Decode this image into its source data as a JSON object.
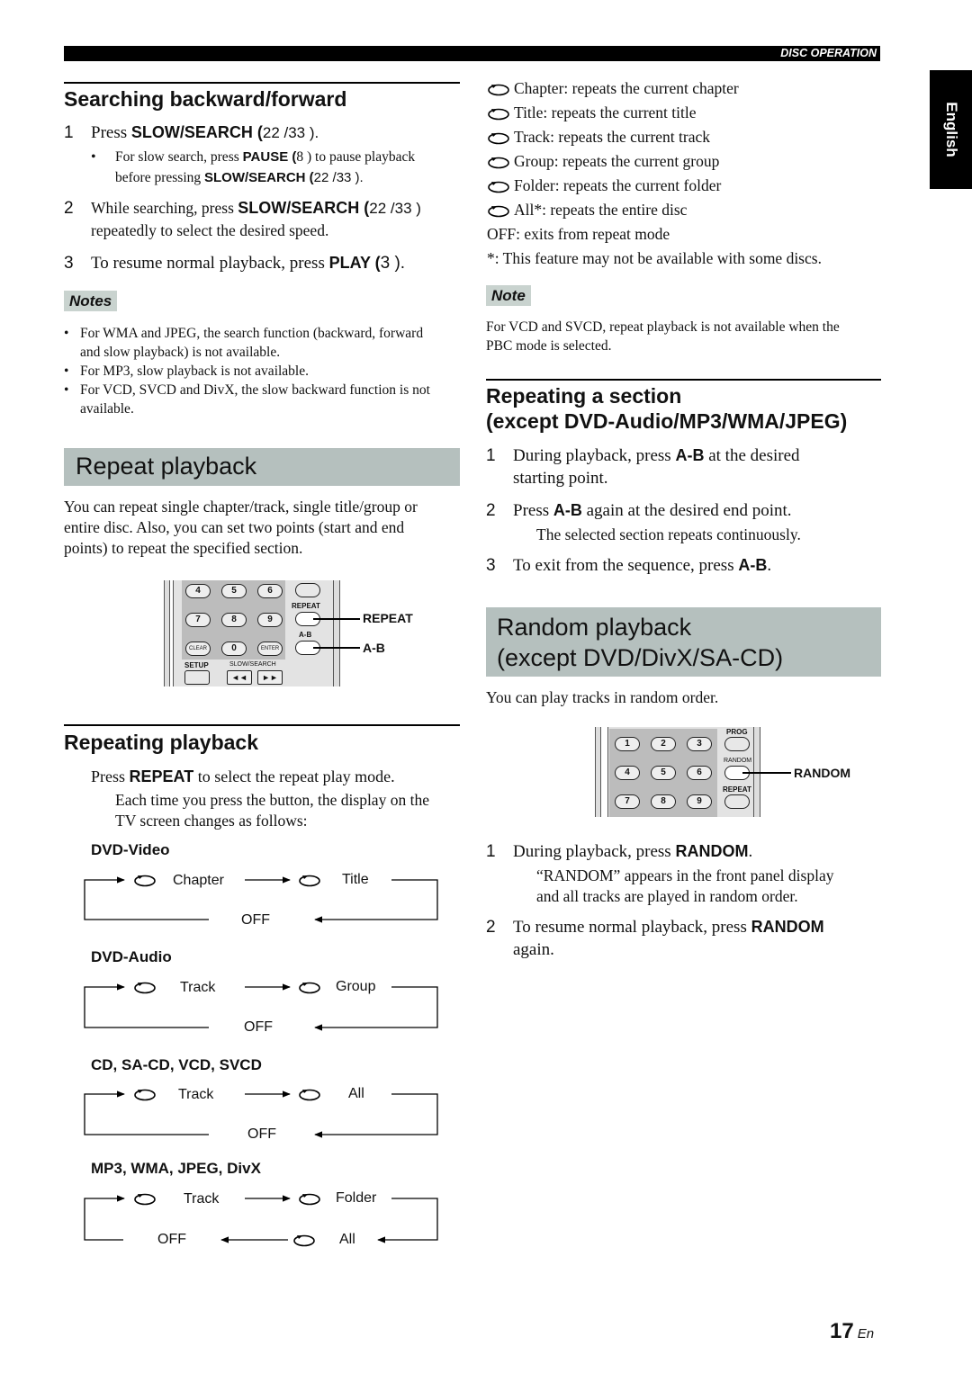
{
  "header": {
    "section": "DISC OPERATION",
    "language_tab": "English"
  },
  "searching": {
    "title": "Searching backward/forward",
    "steps": [
      {
        "num": "1",
        "pre": "Press ",
        "key": "SLOW/SEARCH (",
        "post": "22  /33  ).",
        "bullet": {
          "pre": "For slow search, press ",
          "key1": "PAUSE (",
          "mid1": "8  ) to pause playback",
          "line2_pre": "before pressing ",
          "key2": "SLOW/SEARCH (",
          "post": "22  /33  )."
        }
      },
      {
        "num": "2",
        "pre": "While searching, press ",
        "key": "SLOW/SEARCH (",
        "post": "22  /33  )",
        "line2": "repeatedly to select the desired speed."
      },
      {
        "num": "3",
        "pre": "To resume normal playback, press ",
        "key": "PLAY (",
        "post": "3  )."
      }
    ]
  },
  "notes": {
    "badge": "Notes",
    "items": [
      {
        "line1": "For WMA and JPEG, the search function (backward, forward",
        "line2": "and slow playback) is not available."
      },
      {
        "line1": "For MP3, slow playback is not available.",
        "line2": ""
      },
      {
        "line1": "For VCD, SVCD and DivX, the slow backward function is not",
        "line2": "available."
      }
    ]
  },
  "repeat_playback": {
    "band_title": "Repeat playback",
    "intro": [
      "You can repeat single chapter/track, single title/group or",
      "entire disc. Also, you can set two points (start and end",
      "points) to repeat the specified section."
    ],
    "remote": {
      "keys_row1": [
        "4",
        "5",
        "6"
      ],
      "keys_row2": [
        "7",
        "8",
        "9"
      ],
      "keys_row3": [
        "CLEAR",
        "0",
        "ENTER"
      ],
      "small_repeat": "REPEAT",
      "small_ab": "A-B",
      "setup": "SETUP",
      "slow_search": "SLOW/SEARCH",
      "callout_repeat": "REPEAT",
      "callout_ab": "A-B"
    }
  },
  "repeating": {
    "title": "Repeating playback",
    "press_pre": "Press ",
    "press_key": "REPEAT",
    "press_post": " to select the repeat play mode.",
    "desc": [
      "Each time you press the button, the display on the",
      "TV screen changes as follows:"
    ],
    "flows": [
      {
        "title": "DVD-Video",
        "a": "Chapter",
        "b": "Title",
        "off": "OFF"
      },
      {
        "title": "DVD-Audio",
        "a": "Track",
        "b": "Group",
        "off": "OFF"
      },
      {
        "title": "CD, SA-CD, VCD, SVCD",
        "a": "Track",
        "b": "All",
        "off": "OFF"
      },
      {
        "title": "MP3, WMA, JPEG, DivX",
        "a": "Track",
        "b": "Folder",
        "c": "All",
        "off": "OFF"
      }
    ]
  },
  "modes": {
    "items": [
      "Chapter: repeats the current chapter",
      "Title: repeats the current title",
      "Track: repeats the current track",
      "Group: repeats the current group",
      "Folder: repeats the current folder",
      "All*: repeats the entire disc"
    ],
    "off": "OFF: exits from repeat mode",
    "footnote": "*: This feature may not be available with some discs."
  },
  "note": {
    "badge": "Note",
    "lines": [
      "For VCD and SVCD, repeat playback is not available when the",
      "PBC mode is selected."
    ]
  },
  "section": {
    "title_line1": "Repeating a section",
    "title_line2": "(except DVD-Audio/MP3/WMA/JPEG)",
    "steps": [
      {
        "num": "1",
        "pre": "During playback, press ",
        "key": "A-B",
        "post": " at the desired",
        "line2": "starting point."
      },
      {
        "num": "2",
        "pre": "Press ",
        "key": "A-B",
        "post": " again at the desired end point.",
        "sub": "The selected section repeats continuously."
      },
      {
        "num": "3",
        "pre": "To exit from the sequence, press ",
        "key": "A-B",
        "post": "."
      }
    ]
  },
  "random": {
    "band_line1": "Random playback",
    "band_line2": "(except DVD/DivX/SA-CD)",
    "intro": "You can play tracks in random order.",
    "remote": {
      "keys_row1": [
        "1",
        "2",
        "3"
      ],
      "keys_row2": [
        "4",
        "5",
        "6"
      ],
      "keys_row3": [
        "7",
        "8",
        "9"
      ],
      "small_prog": "PROG",
      "small_random": "RANDOM",
      "small_repeat": "REPEAT",
      "callout": "RANDOM"
    },
    "steps": [
      {
        "num": "1",
        "pre": "During playback, press ",
        "key": "RANDOM",
        "post": ".",
        "sub": [
          "“RANDOM” appears in the front panel display",
          "and all tracks are played in random order."
        ]
      },
      {
        "num": "2",
        "pre": "To resume normal playback, press ",
        "key": "RANDOM",
        "post": "",
        "line2": "again."
      }
    ]
  },
  "footer": {
    "page": "17",
    "lang": "En"
  }
}
